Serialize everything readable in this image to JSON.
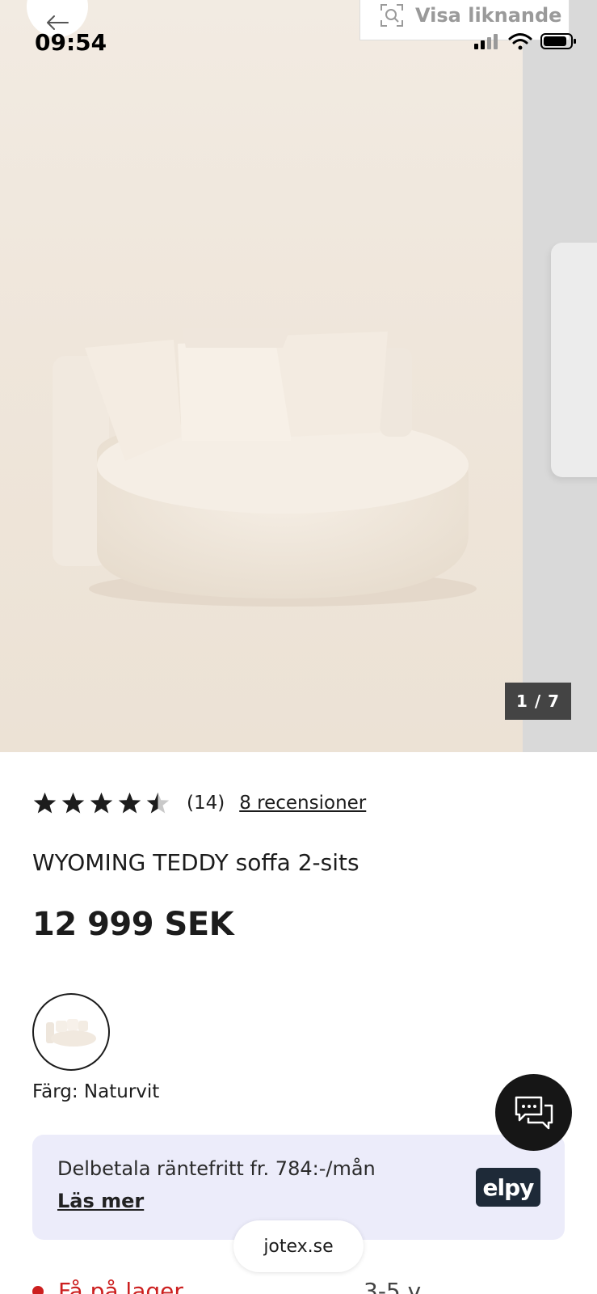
{
  "status_bar": {
    "time": "09:54"
  },
  "gallery": {
    "similar_label": "Visa liknande",
    "counter": "1 / 7"
  },
  "product": {
    "rating_count": "(14)",
    "reviews_link": "8 recensioner",
    "title": "WYOMING TEDDY soffa 2-sits",
    "price": "12 999 SEK",
    "color_label": "Färg: Naturvit"
  },
  "payment": {
    "text": "Delbetala räntefritt fr. 784:-/mån",
    "link": "Läs mer",
    "provider": "elpy"
  },
  "browser": {
    "url": "jotex.se"
  },
  "stock": {
    "text": "Få på lager",
    "extra": "3-5 v"
  },
  "colors": {
    "accent": "#cc1f1f",
    "pay_bg": "#ececfa",
    "chat_bg": "#161616"
  },
  "icons": [
    "back-arrow-icon",
    "visual-search-icon",
    "signal-icon",
    "wifi-icon",
    "battery-icon",
    "star-icon",
    "half-star-icon",
    "chat-icon"
  ]
}
